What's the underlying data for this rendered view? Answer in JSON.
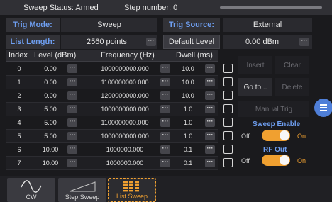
{
  "status": {
    "sweep_status": "Sweep Status: Armed",
    "step_number": "Step number: 0"
  },
  "controls": {
    "trig_mode_label": "Trig Mode:",
    "trig_mode_value": "Sweep",
    "trig_source_label": "Trig Source:",
    "trig_source_value": "External",
    "list_length_label": "List Length:",
    "list_length_value": "2560 points",
    "default_level_button": "Default Level",
    "level_value": "0.00 dBm"
  },
  "table": {
    "headers": [
      "Index",
      "Level (dBm)",
      "Frequency (Hz)",
      "Dwell (ms)"
    ],
    "rows": [
      {
        "index": "0",
        "level": "0.00",
        "frequency": "1000000000.000",
        "dwell": "10.0"
      },
      {
        "index": "1",
        "level": "0.00",
        "frequency": "1100000000.000",
        "dwell": "10.0"
      },
      {
        "index": "2",
        "level": "0.00",
        "frequency": "1200000000.000",
        "dwell": "10.0"
      },
      {
        "index": "3",
        "level": "5.00",
        "frequency": "1000000000.000",
        "dwell": "1.0"
      },
      {
        "index": "4",
        "level": "5.00",
        "frequency": "1100000000.000",
        "dwell": "1.0"
      },
      {
        "index": "5",
        "level": "5.00",
        "frequency": "1000000000.000",
        "dwell": "1.0"
      },
      {
        "index": "6",
        "level": "10.00",
        "frequency": "1000000.000",
        "dwell": "0.1"
      },
      {
        "index": "7",
        "level": "10.00",
        "frequency": "1000000.000",
        "dwell": "0.1"
      }
    ]
  },
  "side": {
    "insert": "Insert",
    "clear": "Clear",
    "goto": "Go to...",
    "delete": "Delete",
    "manual_trig": "Manual Trig",
    "sweep_enable_title": "Sweep Enable",
    "rf_out_title": "RF Out",
    "off": "Off",
    "on": "On"
  },
  "tabs": [
    {
      "label": "CW"
    },
    {
      "label": "Step Sweep"
    },
    {
      "label": "List Sweep"
    }
  ],
  "colors": {
    "accent_blue": "#6e9ef0",
    "accent_orange": "#f0a030",
    "fab_blue": "#4f7fd8"
  },
  "icons": {
    "dots": "ellipsis-icon",
    "menu": "hamburger-menu-icon",
    "cw": "sine-wave-icon",
    "step": "ramp-icon",
    "list": "list-grid-icon"
  }
}
